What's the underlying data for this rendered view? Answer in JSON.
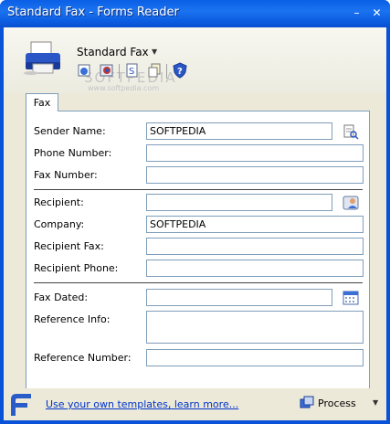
{
  "window": {
    "title": "Standard Fax - Forms Reader",
    "controls": {
      "minimize": "–",
      "maximize": "□",
      "close": "✕"
    }
  },
  "toolbar": {
    "template_name": "Standard Fax",
    "caret": "▼",
    "icons": [
      "printer-icon",
      "open-icon",
      "save-icon",
      "template-icon",
      "copy-icon",
      "help-icon"
    ]
  },
  "watermark": {
    "text": "SOFTPEDIA",
    "subtext": "www.softpedia.com"
  },
  "tabs": [
    {
      "label": "Fax"
    }
  ],
  "form": {
    "sender_name": {
      "label": "Sender Name:",
      "value": "SOFTPEDIA"
    },
    "phone_number": {
      "label": "Phone Number:",
      "value": ""
    },
    "fax_number": {
      "label": "Fax Number:",
      "value": ""
    },
    "recipient": {
      "label": "Recipient:",
      "value": ""
    },
    "company": {
      "label": "Company:",
      "value": "SOFTPEDIA"
    },
    "recipient_fax": {
      "label": "Recipient Fax:",
      "value": ""
    },
    "recipient_phone": {
      "label": "Recipient Phone:",
      "value": ""
    },
    "fax_dated": {
      "label": "Fax Dated:",
      "value": ""
    },
    "reference_info": {
      "label": "Reference Info:",
      "value": ""
    },
    "reference_number": {
      "label": "Reference Number:",
      "value": ""
    }
  },
  "footer": {
    "link": "Use your own templates, learn more...",
    "process_label": "Process",
    "process_caret": "▼"
  },
  "colors": {
    "titlebar": "#0a5fe6",
    "client_bg": "#ece9d8",
    "field_border": "#7f9db9",
    "link": "#0033cc"
  }
}
